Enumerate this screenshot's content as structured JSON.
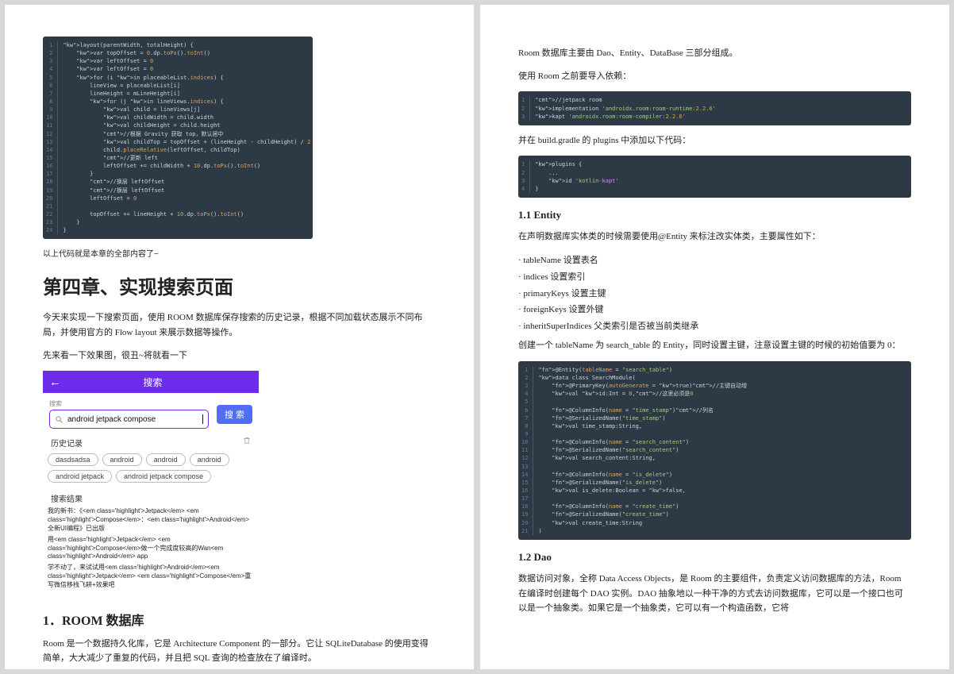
{
  "left": {
    "code1": "layout(parentWidth, totalHeight) {\n    var topOffset = 0.dp.toPx().toInt()\n    var leftOffset = 0\n    var leftOffset = 0\n    for (i in placeableList.indices) {\n        lineView = placeableList[i]\n        lineHeight = mLineHeight[i]\n        for (j in lineViews.indices) {\n            val child = lineViews[j]\n            val childWidth = child.width\n            val childHeight = child.height\n            //根据 Gravity 获取 top，默认居中\n            val childTop = topOffset + (lineHeight - childHeight) / 2\n            child.placeRelative(leftOffset, childTop)\n            //更新 left\n            leftOffset += childWidth + 10.dp.toPx().toInt()\n        }\n        //换层 leftOffset\n        //换层 leftOffset\n        leftOffset = 0\n\n        topOffset += lineHeight + 10.dp.toPx().toInt()\n    }\n}",
    "note": "以上代码就是本章的全部内容了~",
    "h1": "第四章、实现搜索页面",
    "p1": "今天来实现一下搜索页面，使用 ROOM 数据库保存搜索的历史记录，根据不同加载状态展示不同布局，并使用官方的 Flow layout 来展示数据等操作。",
    "p2": "先来看一下效果图，很丑~将就看一下",
    "phone": {
      "appbar_title": "搜索",
      "search_hint": "搜索",
      "search_value": "android jetpack compose",
      "search_button": "搜 索",
      "history_label": "历史记录",
      "chips": [
        "dasdsadsa",
        "android",
        "android",
        "android",
        "android jetpack",
        "android jetpack compose"
      ],
      "results_label": "搜索结果",
      "results": [
        "我的新书：《<em class='highlight'>Jetpack</em> <em class='highlight'>Compose</em>：<em class='highlight'>Android</em>全新UI编程》已出版",
        "用<em class='highlight'>Jetpack</em> <em class='highlight'>Compose</em>做一个完成度较高的Wan<em class='highlight'>Android</em> app",
        "学不动了，来试试用<em class='highlight'>Android</em><em class='highlight'>Jetpack</em> <em class='highlight'>Compose</em>重写微信移栈飞耕+效果吧"
      ]
    },
    "h2": "1．ROOM 数据库",
    "p3": "Room 是一个数据持久化库，它是 Architecture Component 的一部分。它让 SQLiteDatabase 的使用变得简单，大大减少了重复的代码，并且把 SQL 查询的检查放在了编译时。"
  },
  "right": {
    "p1": "Room 数据库主要由 Dao、Entity、DataBase 三部分组成。",
    "p2": "使用 Room 之前要导入依赖：",
    "code2": "//jetpack room\nimplementation 'androidx.room:room-runtime:2.2.6'\nkapt 'androidx.room:room-compiler:2.2.6'",
    "p3": "并在 build.gradle 的 plugins 中添加以下代码：",
    "code3": "plugins {\n    ...\n    id 'kotlin-kapt'\n}",
    "h11": "1.1 Entity",
    "p4": "在声明数据库实体类的时候需要使用@Entity 来标注改实体类，主要属性如下：",
    "bullets": [
      "· tableName  设置表名",
      "· indices  设置索引",
      "· primaryKeys  设置主键",
      "· foreignKeys  设置外键",
      "· inheritSuperIndices  父类索引是否被当前类继承"
    ],
    "p5": "创建一个 tableName 为 search_table 的 Entity，同时设置主键，注意设置主键的时候的初始值要为 0：",
    "code4": "@Entity(tableName = \"search_table\")\ndata class SearchModule(\n    @PrimaryKey(autoGenerate = true)//主键自动增\n    val id:Int = 0,//这里必须是0\n\n    @ColumnInfo(name = \"time_stamp\")//列名\n    @SerializedName(\"time_stamp\")\n    val time_stamp:String,\n\n    @ColumnInfo(name = \"search_content\")\n    @SerializedName(\"search_content\")\n    val search_content:String,\n\n    @ColumnInfo(name = \"is_delete\")\n    @SerializedName(\"is_delete\")\n    val is_delete:Boolean = false,\n\n    @ColumnInfo(name = \"create_time\")\n    @SerializedName(\"create_time\")\n    val create_time:String\n)",
    "h12": "1.2 Dao",
    "p6": "数据访问对象，全称 Data Access Objects，是 Room 的主要组件，负责定义访问数据库的方法，Room 在编译时创建每个 DAO 实例。DAO 抽象地以一种干净的方式去访问数据库，它可以是一个接口也可以是一个抽象类。如果它是一个抽象类，它可以有一个构造函数，它将"
  }
}
